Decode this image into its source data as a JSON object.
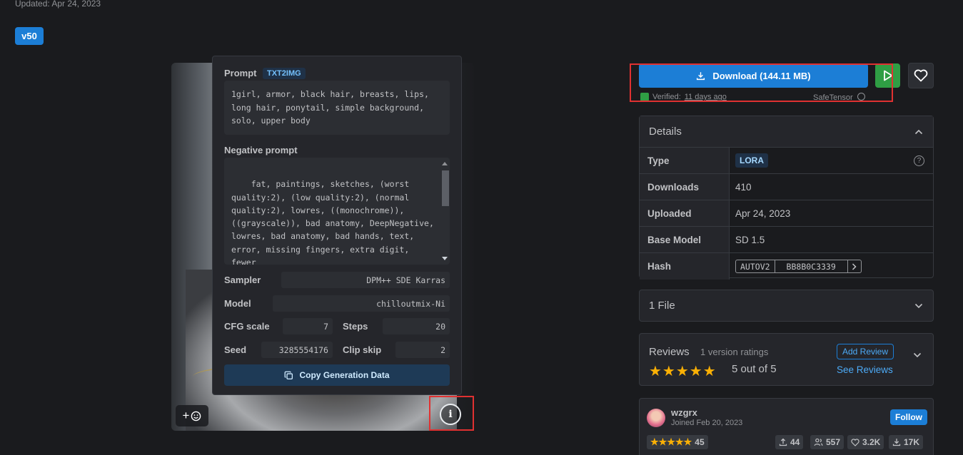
{
  "header": {
    "updated": "Updated: Apr 24, 2023",
    "version": "v50"
  },
  "generation": {
    "prompt_label": "Prompt",
    "mode_badge": "TXT2IMG",
    "prompt": "1girl, armor, black hair, breasts, lips,\nlong hair, ponytail, simple background,\nsolo, upper body",
    "negative_label": "Negative prompt",
    "negative_prompt": "fat, paintings, sketches, (worst\nquality:2), (low quality:2), (normal\nquality:2), lowres, ((monochrome)),\n((grayscale)), bad anatomy, DeepNegative,\nlowres, bad anatomy, bad hands, text,\nerror, missing fingers, extra digit, fewer\ndigits, cropped, worst quality, low\nquality, normal quality, jpeg artifacts",
    "sampler_label": "Sampler",
    "sampler": "DPM++ SDE Karras",
    "model_label": "Model",
    "model": "chilloutmix-Ni",
    "cfg_label": "CFG scale",
    "cfg": "7",
    "steps_label": "Steps",
    "steps": "20",
    "seed_label": "Seed",
    "seed": "3285554176",
    "clip_label": "Clip skip",
    "clip": "2",
    "copy_label": "Copy Generation Data"
  },
  "image_controls": {
    "add_icon": "+",
    "info_icon": "i"
  },
  "download": {
    "label": "Download (144.11 MB)",
    "verified_prefix": "Verified:",
    "verified_date": "11 days ago",
    "safetensor": "SafeTensor"
  },
  "details": {
    "title": "Details",
    "rows": [
      {
        "key": "Type",
        "value": "LORA"
      },
      {
        "key": "Downloads",
        "value": "410"
      },
      {
        "key": "Uploaded",
        "value": "Apr 24, 2023"
      },
      {
        "key": "Base Model",
        "value": "SD 1.5"
      },
      {
        "key": "Hash",
        "hash_type": "AUTOV2",
        "hash_value": "BB8B0C3339"
      }
    ]
  },
  "files": {
    "title": "1 File"
  },
  "reviews": {
    "title": "Reviews",
    "count": "1 version ratings",
    "stars": "★★★★★",
    "score": "5 out of 5",
    "add": "Add Review",
    "see": "See Reviews"
  },
  "creator": {
    "name": "wzgrx",
    "joined": "Joined Feb 20, 2023",
    "follow": "Follow",
    "rating_stars": "★★★★★",
    "rating_count": "45",
    "uploads": "44",
    "followers": "557",
    "favorites": "3.2K",
    "downloads": "17K"
  },
  "colors": {
    "accent": "#1c7ed6",
    "success": "#2f9e44",
    "highlight": "#e03131",
    "star": "#fab005"
  }
}
